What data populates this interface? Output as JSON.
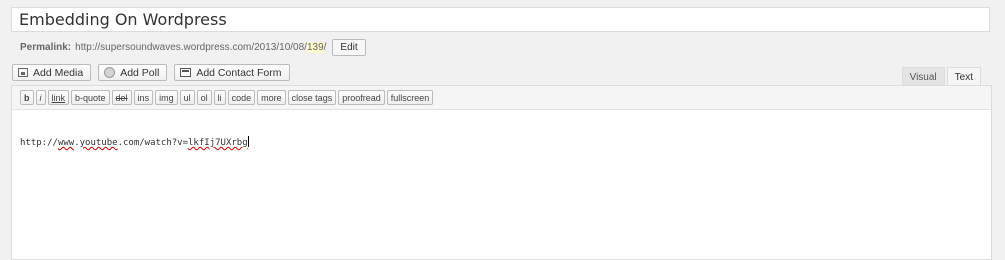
{
  "post": {
    "title": "Embedding On Wordpress"
  },
  "permalink": {
    "label": "Permalink:",
    "url_prefix": "http://supersoundwaves.wordpress.com/2013/10/08/",
    "slug": "139",
    "url_suffix": "/",
    "edit_label": "Edit"
  },
  "media_buttons": {
    "add_media": "Add Media",
    "add_poll": "Add Poll",
    "add_contact_form": "Add Contact Form"
  },
  "editor_tabs": {
    "visual": "Visual",
    "text": "Text",
    "active": "Text"
  },
  "quicktags": {
    "b": "b",
    "i": "i",
    "link": "link",
    "bquote": "b-quote",
    "del": "del",
    "ins": "ins",
    "img": "img",
    "ul": "ul",
    "ol": "ol",
    "li": "li",
    "code": "code",
    "more": "more",
    "close_tags": "close tags",
    "proofread": "proofread",
    "fullscreen": "fullscreen"
  },
  "content": {
    "text_part1": "http://",
    "text_part2": "www",
    "text_part3": ".",
    "text_part4": "youtube",
    "text_part5": ".com/watch?v=",
    "text_part6": "lkfIj7UXrbg"
  },
  "colors": {
    "background": "#f1f1f1",
    "slug_highlight": "#fffbcc",
    "spellcheck_underline": "#d40000"
  }
}
